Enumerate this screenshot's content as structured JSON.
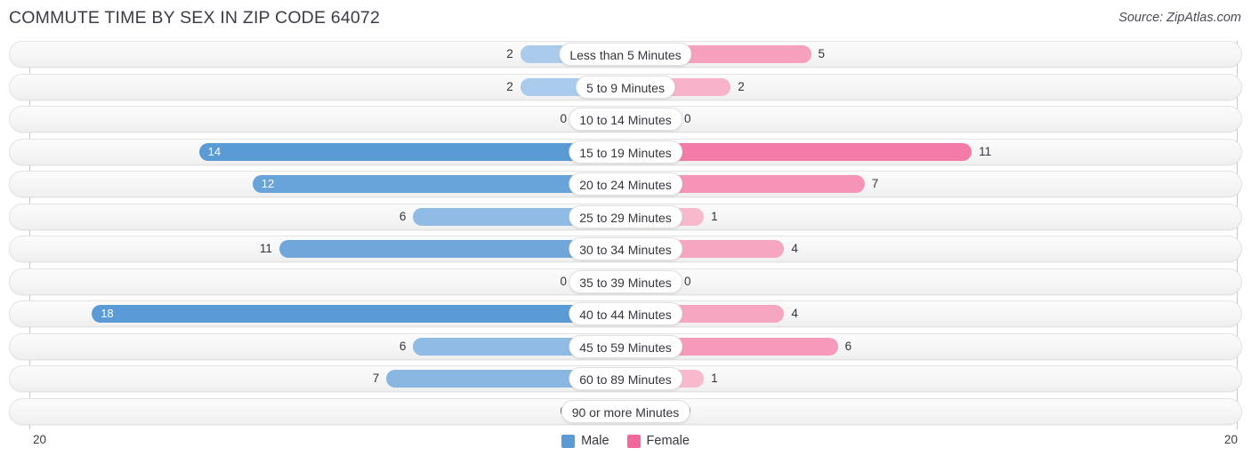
{
  "header": {
    "title": "COMMUTE TIME BY SEX IN ZIP CODE 64072",
    "source": "Source: ZipAtlas.com"
  },
  "legend": {
    "items": [
      {
        "label": "Male",
        "color": "#5b9bd5"
      },
      {
        "label": "Female",
        "color": "#f2679c"
      }
    ]
  },
  "axis": {
    "min_label": "20",
    "max_label": "20",
    "max_value": 20
  },
  "chart_data": {
    "type": "bar",
    "title": "COMMUTE TIME BY SEX IN ZIP CODE 64072",
    "subtitle": "",
    "xlabel": "",
    "ylabel": "",
    "orientation": "horizontal",
    "layout": "diverging-bidirectional",
    "grid": false,
    "legend_position": "bottom-center",
    "xlim": [
      20,
      20
    ],
    "categories": [
      "Less than 5 Minutes",
      "5 to 9 Minutes",
      "10 to 14 Minutes",
      "15 to 19 Minutes",
      "20 to 24 Minutes",
      "25 to 29 Minutes",
      "30 to 34 Minutes",
      "35 to 39 Minutes",
      "40 to 44 Minutes",
      "45 to 59 Minutes",
      "60 to 89 Minutes",
      "90 or more Minutes"
    ],
    "series": [
      {
        "name": "Male",
        "color": "#5b9bd5",
        "values": [
          2,
          2,
          0,
          14,
          12,
          6,
          11,
          0,
          18,
          6,
          7,
          0
        ]
      },
      {
        "name": "Female",
        "color": "#f2679c",
        "values": [
          5,
          2,
          0,
          11,
          7,
          1,
          4,
          0,
          4,
          6,
          1,
          0
        ]
      }
    ]
  }
}
